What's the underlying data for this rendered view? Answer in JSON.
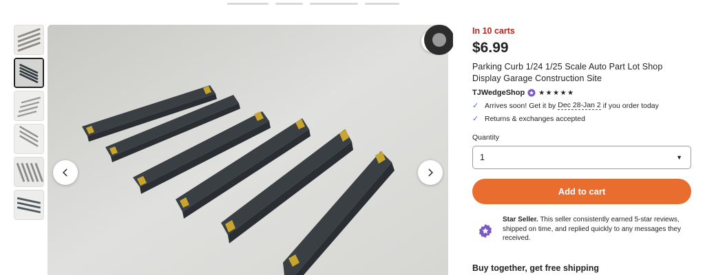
{
  "listing": {
    "in_carts": "In 10 carts",
    "price": "$6.99",
    "title": "Parking Curb 1/24 1/25 Scale Auto Part Lot Shop Display Garage Construction Site",
    "shop_name": "TJWedgeShop",
    "rating_stars": "★★★★★",
    "rating_value": 5
  },
  "features": {
    "arrives_prefix": "Arrives soon! Get it by",
    "arrives_dates": "Dec 28-Jan 2",
    "arrives_suffix": "if you order today",
    "returns": "Returns & exchanges accepted"
  },
  "quantity": {
    "label": "Quantity",
    "selected": "1"
  },
  "buttons": {
    "add_to_cart": "Add to cart"
  },
  "seller": {
    "title": "Star Seller.",
    "description": "This seller consistently earned 5-star reviews, shipped on time, and replied quickly to any messages they received."
  },
  "section": {
    "buy_together": "Buy together, get free shipping"
  },
  "gallery": {
    "thumbnail_count": 6,
    "active_index": 1
  },
  "colors": {
    "accent": "#e86d2f",
    "in_carts": "#b3261e",
    "check": "#4d6bc6",
    "star_seller": "#7b5ac8"
  },
  "icons": {
    "favorite": "heart-icon",
    "prev": "chevron-left-icon",
    "next": "chevron-right-icon",
    "check": "check-icon",
    "dropdown": "caret-down-icon",
    "seller_badge": "star-seller-badge-icon"
  }
}
